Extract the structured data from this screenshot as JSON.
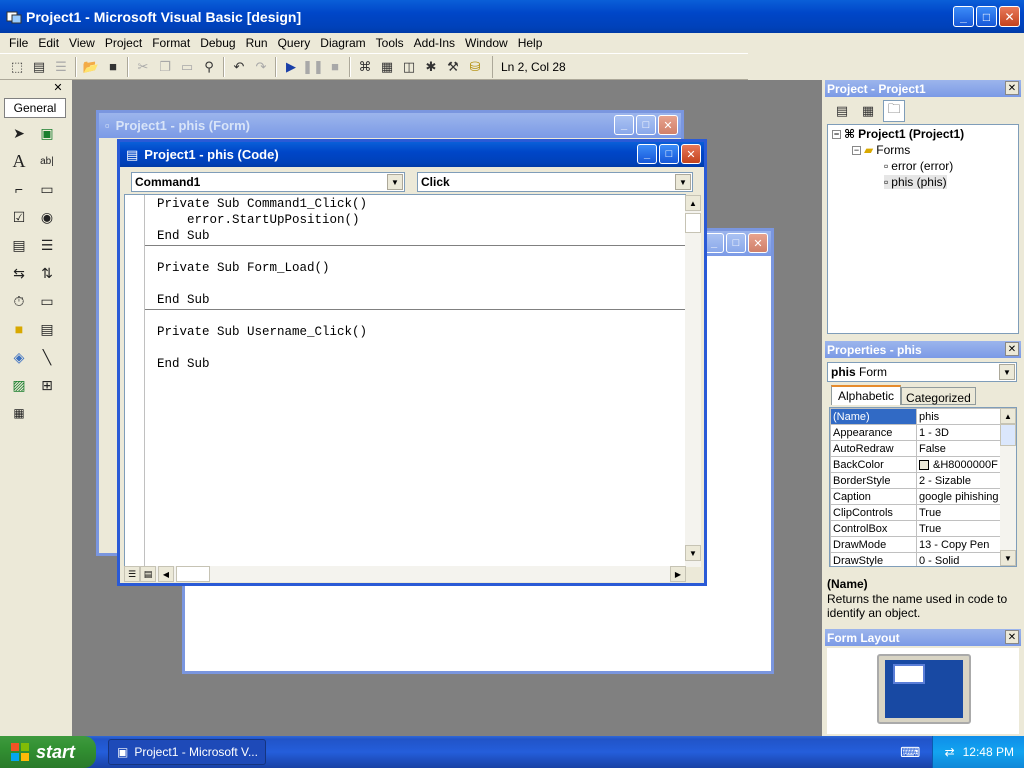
{
  "app": {
    "title": "Project1 - Microsoft Visual Basic [design]",
    "caption_buttons": {
      "minimize": "_",
      "maximize": "□",
      "close": "✕"
    }
  },
  "menubar": {
    "items": [
      "File",
      "Edit",
      "View",
      "Project",
      "Format",
      "Debug",
      "Run",
      "Query",
      "Diagram",
      "Tools",
      "Add-Ins",
      "Window",
      "Help"
    ]
  },
  "toolbar": {
    "cursor_position": "Ln 2, Col 28"
  },
  "toolbox": {
    "tab_label": "General",
    "close": "✕"
  },
  "windows": {
    "form_window_title": "Project1 - phis (Form)",
    "code_window_title": "Project1 - phis (Code)",
    "object_combo": "Command1",
    "procedure_combo": "Click",
    "code_lines": [
      "Private Sub Command1_Click()",
      "    error.StartUpPosition()",
      "End Sub",
      "Private Sub Form_Load()",
      "End Sub",
      "Private Sub Username_Click()",
      "End Sub"
    ]
  },
  "project_panel": {
    "title": "Project - Project1",
    "tree": {
      "root": "Project1 (Project1)",
      "folder": "Forms",
      "items": [
        "error (error)",
        "phis (phis)"
      ]
    }
  },
  "properties_panel": {
    "title": "Properties - phis",
    "object_name": "phis",
    "object_type": "Form",
    "tabs": [
      "Alphabetic",
      "Categorized"
    ],
    "rows": [
      {
        "name": "(Name)",
        "value": "phis"
      },
      {
        "name": "Appearance",
        "value": "1 - 3D"
      },
      {
        "name": "AutoRedraw",
        "value": "False"
      },
      {
        "name": "BackColor",
        "value": "&H8000000F"
      },
      {
        "name": "BorderStyle",
        "value": "2 - Sizable"
      },
      {
        "name": "Caption",
        "value": "google pihishing"
      },
      {
        "name": "ClipControls",
        "value": "True"
      },
      {
        "name": "ControlBox",
        "value": "True"
      },
      {
        "name": "DrawMode",
        "value": "13 - Copy Pen"
      },
      {
        "name": "DrawStyle",
        "value": "0 - Solid"
      }
    ],
    "description_title": "(Name)",
    "description_text": "Returns the name used in code to identify an object."
  },
  "form_layout_panel": {
    "title": "Form Layout"
  },
  "taskbar": {
    "start_label": "start",
    "task_button": "Project1 - Microsoft V...",
    "clock": "12:48 PM"
  },
  "colors": {
    "title_blue": "#0046c8",
    "mdi_gray": "#808080",
    "start_green": "#329032",
    "selection": "#316ac5"
  }
}
